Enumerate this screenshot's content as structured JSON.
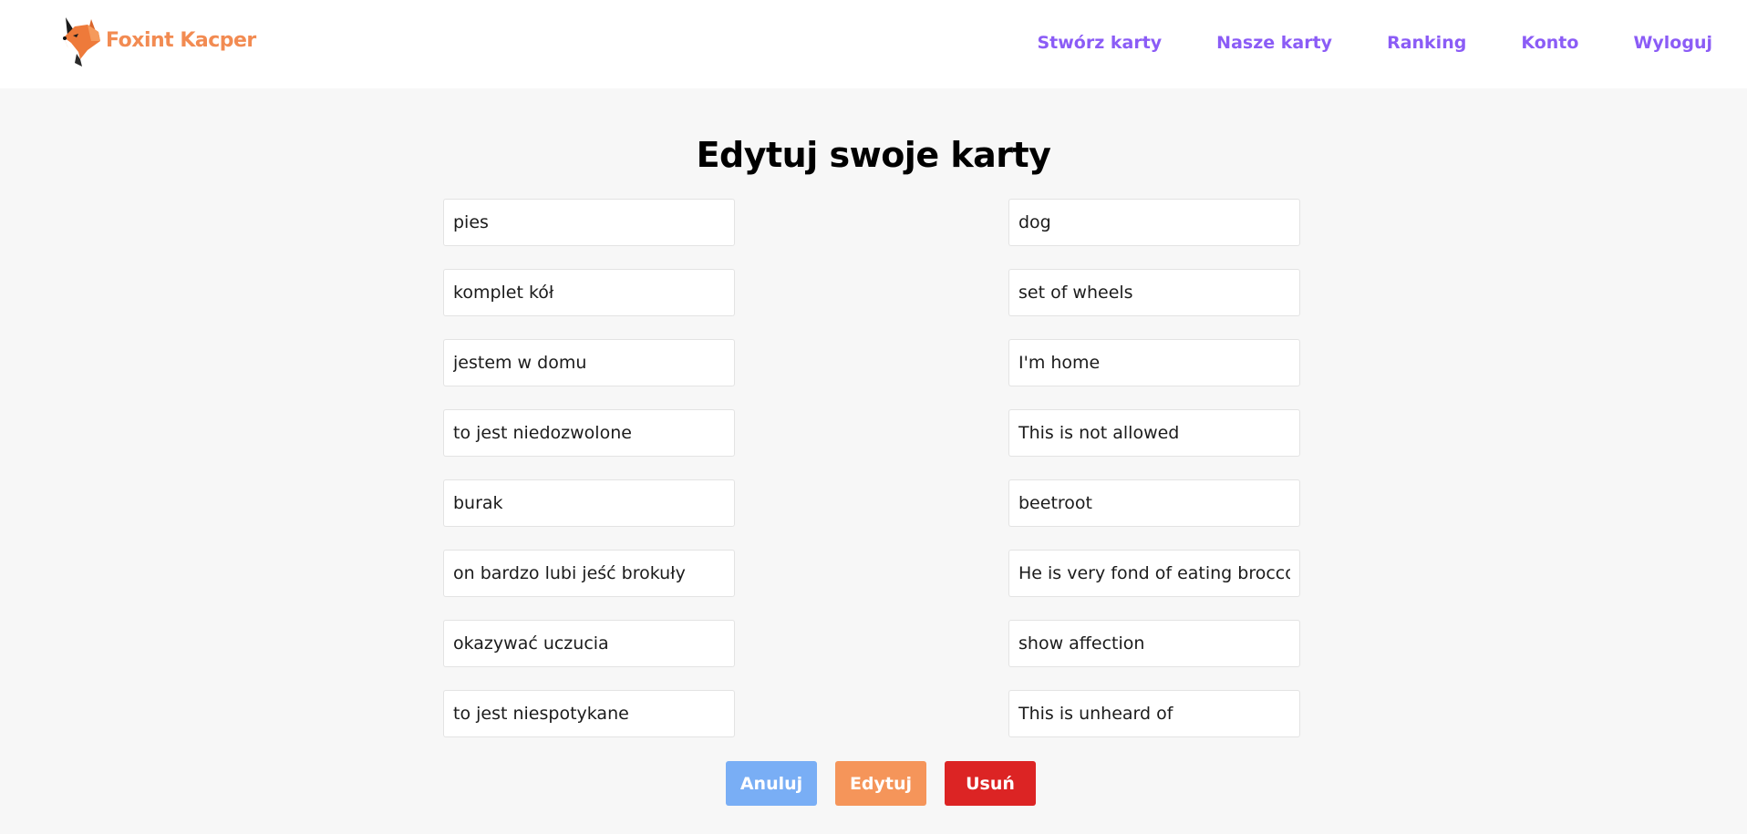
{
  "header": {
    "brand_name": "Foxint Kacper",
    "nav": [
      {
        "label": "Stwórz karty"
      },
      {
        "label": "Nasze karty"
      },
      {
        "label": "Ranking"
      },
      {
        "label": "Konto"
      },
      {
        "label": "Wyloguj"
      }
    ]
  },
  "page": {
    "title": "Edytuj swoje karty"
  },
  "cards": [
    {
      "front": "pies",
      "back": "dog"
    },
    {
      "front": "komplet kół",
      "back": "set of wheels"
    },
    {
      "front": "jestem w domu",
      "back": "I'm home"
    },
    {
      "front": "to jest niedozwolone",
      "back": "This is not allowed"
    },
    {
      "front": "burak",
      "back": "beetroot"
    },
    {
      "front": "on bardzo lubi jeść brokuły",
      "back": "He is very fond of eating broccoli"
    },
    {
      "front": "okazywać uczucia",
      "back": "show affection"
    },
    {
      "front": "to jest niespotykane",
      "back": "This is unheard of"
    }
  ],
  "actions": {
    "cancel_label": "Anuluj",
    "edit_label": "Edytuj",
    "delete_label": "Usuń"
  },
  "colors": {
    "accent_nav": "#8b5cf6",
    "brand": "#f28b52",
    "cancel": "#79aef5",
    "edit": "#f5955a",
    "delete": "#dc2424"
  },
  "icons": {
    "logo": "fox-logo-icon"
  }
}
